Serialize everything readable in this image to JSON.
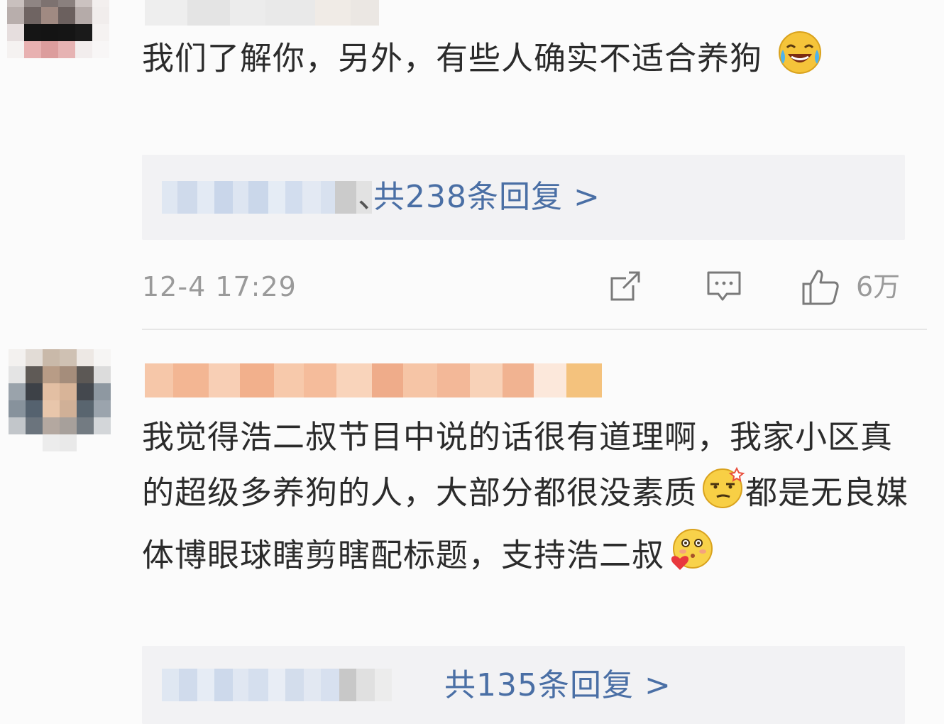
{
  "comment1": {
    "text": "我们了解你，另外，有些人确实不适合养狗",
    "emoji": "laugh-cry-emoji",
    "reply_separator": "、",
    "reply_link": "共238条回复 >",
    "timestamp": "12-4 17:29",
    "like_count": "6万"
  },
  "comment2": {
    "text_part1": "我觉得浩二叔节目中说的话很有道理啊，我家小区真的超级多养狗的人，大部分都很没素质",
    "emoji1": "smug-face-emoji",
    "text_part2": "都是无良媒体博眼球瞎剪瞎配标题，支持浩二叔",
    "emoji2": "heart-blush-emoji",
    "reply_link": "共135条回复 >"
  },
  "colors": {
    "link": "#4a6fa5",
    "text": "#2b2b2b",
    "meta": "#9a9a9a",
    "reply_bg": "#f2f2f4"
  },
  "icons": [
    "share-icon",
    "comment-icon",
    "like-icon"
  ]
}
